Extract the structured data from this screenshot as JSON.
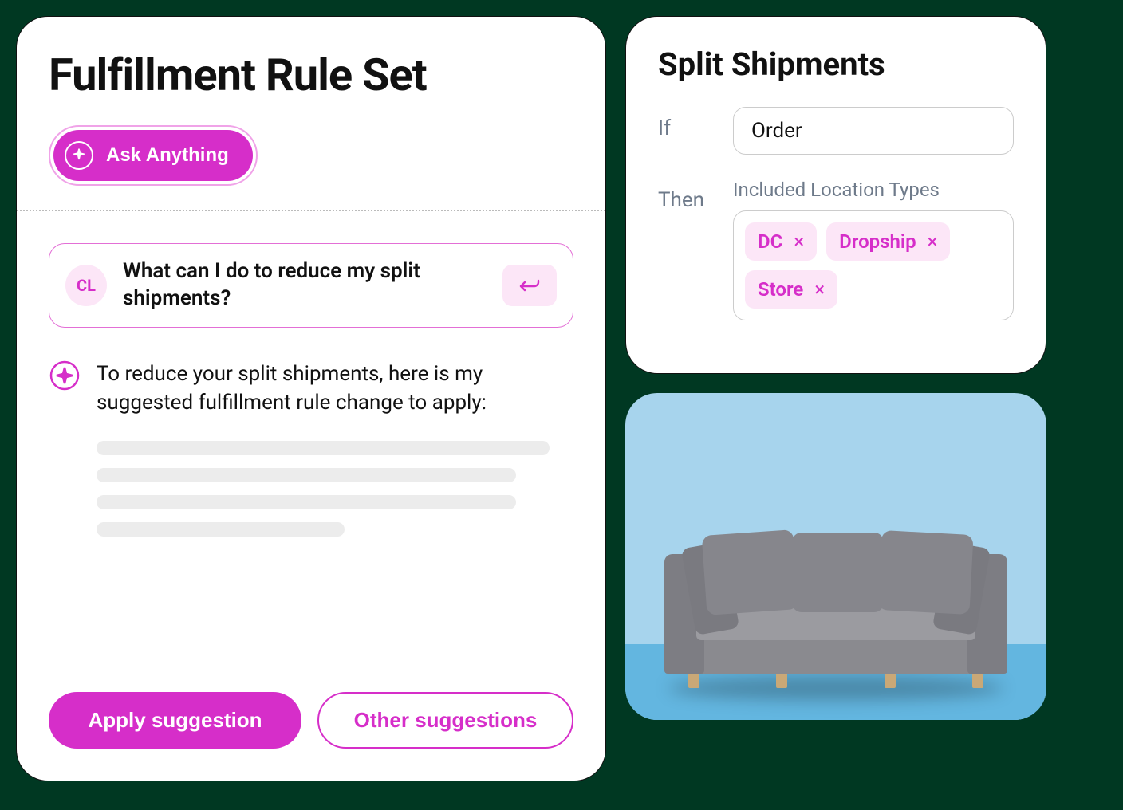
{
  "left": {
    "title": "Fulfillment Rule Set",
    "ask_label": "Ask Anything",
    "chat": {
      "avatar_initials": "CL",
      "question": "What can I do to reduce my split shipments?"
    },
    "ai": {
      "response": "To reduce your split shipments, here is my suggested fulfillment rule change to apply:"
    },
    "actions": {
      "apply_label": "Apply suggestion",
      "other_label": "Other suggestions"
    }
  },
  "right": {
    "title": "Split Shipments",
    "if_label": "If",
    "if_value": "Order",
    "then_label": "Then",
    "then_subtitle": "Included Location Types",
    "tags": [
      {
        "label": "DC"
      },
      {
        "label": "Dropship"
      },
      {
        "label": "Store"
      }
    ]
  },
  "image": {
    "description": "Gray sofa product image"
  }
}
